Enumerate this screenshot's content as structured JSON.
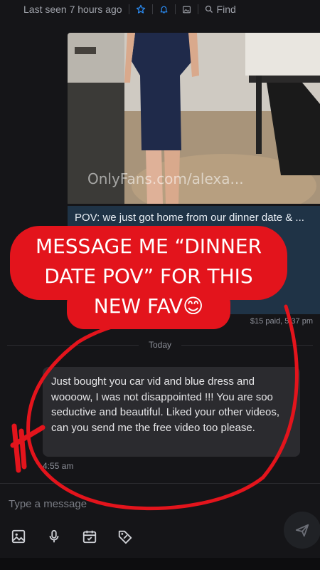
{
  "header": {
    "last_seen": "Last seen 7 hours ago",
    "find_label": "Find",
    "icons": [
      "star-icon",
      "bell-icon",
      "image-icon",
      "search-icon"
    ],
    "accent": "#2a8bf2"
  },
  "media_post": {
    "watermark": "OnlyFans.com/alexa...",
    "caption": "POV: we just got home from our dinner date & ... on ... et your ... ink of ... OV videos ;",
    "paid_meta": "$15 paid, 5:37 pm",
    "caption_bg": "#1f3346"
  },
  "day_divider": {
    "label": "Today"
  },
  "message": {
    "text": "Just bought you car vid and blue dress and woooow, I was not disappointed !!! You are soo seductive and beautiful. Liked your other videos, can you send me the free video too please.",
    "time": "4:55 am"
  },
  "composer": {
    "placeholder": "Type a message",
    "tools": [
      "image-icon",
      "microphone-icon",
      "calendar-check-icon",
      "price-tag-icon"
    ],
    "send_icon": "send-icon"
  },
  "overlay": {
    "lines": [
      "MESSAGE ME “DINNER",
      "DATE POV” FOR THIS",
      "NEW FAV😊"
    ],
    "color": "#e3141c"
  }
}
